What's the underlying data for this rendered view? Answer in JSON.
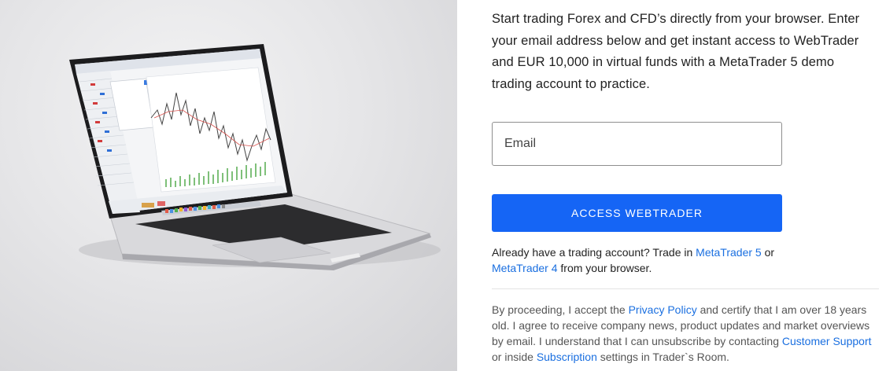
{
  "hero": {
    "image": "laptop-with-trading-platform"
  },
  "intro": {
    "text": "Start trading Forex and CFD’s directly from your browser. Enter your email address below and get instant access to WebTrader and EUR 10,000 in virtual funds with a MetaTrader 5 demo trading account to practice."
  },
  "form": {
    "email_placeholder": "Email",
    "email_value": "",
    "submit_label": "ACCESS WEBTRADER",
    "accent_color": "#1565f5"
  },
  "already": {
    "prefix": "Already have a trading account? Trade in ",
    "link_mt5": "MetaTrader 5",
    "middle": " or",
    "link_mt4": "MetaTrader 4",
    "suffix": " from your browser."
  },
  "legal": {
    "part1": "By proceeding, I accept the ",
    "privacy_link": "Privacy Policy",
    "part2": " and certify that I am over 18 years old. I agree to receive company news, product updates and market overviews by email. I understand that I can unsubscribe by contacting ",
    "support_link": "Customer Support",
    "part3": " or inside ",
    "subscription_link": "Subscription",
    "part4": " settings in Trader`s Room."
  },
  "colors": {
    "link": "#1a6fe0",
    "button": "#1565f5"
  }
}
